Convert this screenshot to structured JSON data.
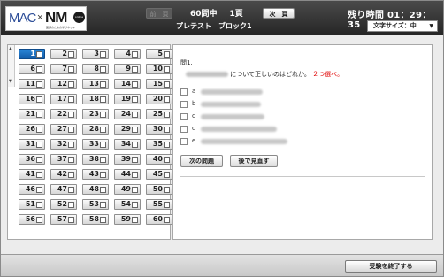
{
  "header": {
    "logo": {
      "mac": "MAC",
      "x": "×",
      "nm": "NM",
      "online": "online",
      "tag": "医師のための学びネット"
    },
    "prev_label": "前　頁",
    "next_label": "次　頁",
    "question_count": "60問中",
    "page_number": "1頁",
    "block_title": "プレテスト　ブロック1",
    "time_remaining": "残り時間 01：29：35",
    "font_size_label": "文字サイズ：中",
    "font_size_arrow": "▼"
  },
  "questions": {
    "current": 1,
    "numbers": [
      1,
      2,
      3,
      4,
      5,
      6,
      7,
      8,
      9,
      10,
      11,
      12,
      13,
      14,
      15,
      16,
      17,
      18,
      19,
      20,
      21,
      22,
      23,
      24,
      25,
      26,
      27,
      28,
      29,
      30,
      31,
      32,
      33,
      34,
      35,
      36,
      37,
      38,
      39,
      40,
      41,
      42,
      43,
      44,
      45,
      46,
      47,
      48,
      49,
      50,
      51,
      52,
      53,
      54,
      55,
      56,
      57,
      58,
      59,
      60
    ]
  },
  "scroll": {
    "up": "▲",
    "down": "▼"
  },
  "question": {
    "label": "問1.",
    "stem_visible": "について正しいのはどれか。",
    "stem_instruction": "２つ選べ。",
    "choices": [
      {
        "letter": "a"
      },
      {
        "letter": "b"
      },
      {
        "letter": "c"
      },
      {
        "letter": "d"
      },
      {
        "letter": "e"
      }
    ]
  },
  "buttons": {
    "next_question": "次の問題",
    "review_later": "後で見直す",
    "finish_exam": "受験を終了する"
  }
}
